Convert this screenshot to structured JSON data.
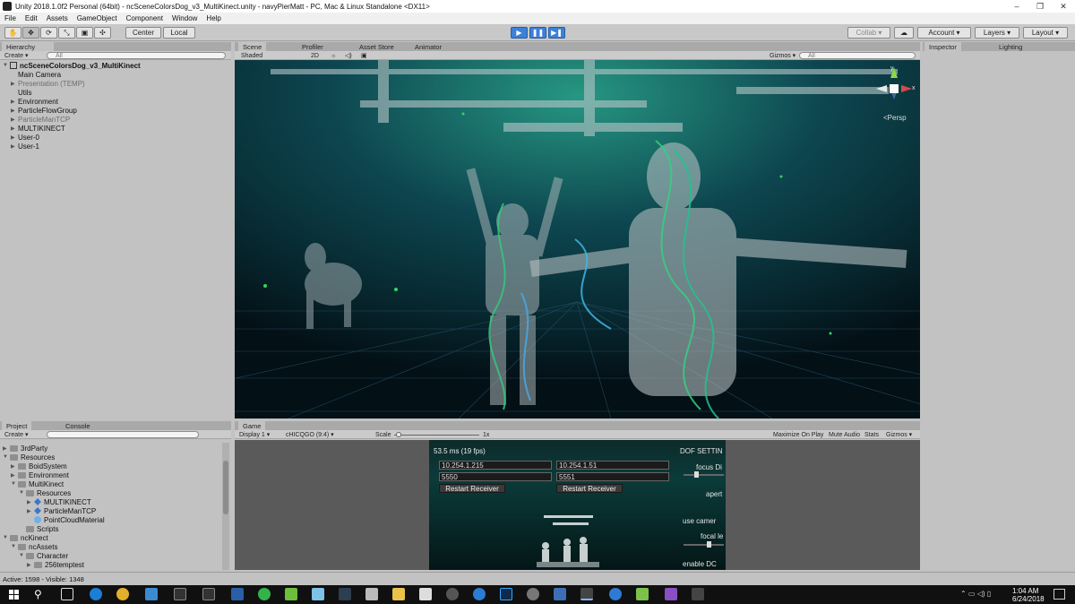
{
  "window": {
    "title": "Unity 2018.1.0f2 Personal (64bit) - ncSceneColorsDog_v3_MultiKinect.unity - navyPierMatt - PC, Mac & Linux Standalone <DX11>",
    "minimize": "–",
    "maximize": "❐",
    "close": "✕"
  },
  "menu": [
    "File",
    "Edit",
    "Assets",
    "GameObject",
    "Component",
    "Window",
    "Help"
  ],
  "toolbar": {
    "tools": [
      "✋",
      "✥",
      "⟳",
      "⤡",
      "▣",
      "✣"
    ],
    "pivot": "Center",
    "space": "Local",
    "play_buttons": [
      "▶",
      "❚❚",
      "▶❚"
    ],
    "collab": "Collab ▾",
    "cloud_icon": "☁",
    "account": "Account ▾",
    "layers": "Layers ▾",
    "layout": "Layout ▾"
  },
  "hierarchy": {
    "tab": "Hierarchy",
    "create": "Create ▾",
    "search_placeholder": "All",
    "scene": "ncSceneColorsDog_v3_MultiKinect",
    "items": [
      {
        "label": "Main Camera",
        "indent": 1,
        "arrow": "",
        "dim": false
      },
      {
        "label": "Presentation (TEMP)",
        "indent": 1,
        "arrow": "▶",
        "dim": true
      },
      {
        "label": "Utils",
        "indent": 1,
        "arrow": "",
        "dim": false
      },
      {
        "label": "Environment",
        "indent": 1,
        "arrow": "▶",
        "dim": false
      },
      {
        "label": "ParticleFlowGroup",
        "indent": 1,
        "arrow": "▶",
        "dim": false
      },
      {
        "label": "ParticleManTCP",
        "indent": 1,
        "arrow": "▶",
        "dim": true
      },
      {
        "label": "MULTIKINECT",
        "indent": 1,
        "arrow": "▶",
        "dim": false
      },
      {
        "label": "User-0",
        "indent": 1,
        "arrow": "▶",
        "dim": false
      },
      {
        "label": "User-1",
        "indent": 1,
        "arrow": "▶",
        "dim": false
      }
    ]
  },
  "scene": {
    "tabs": [
      "Scene",
      "Profiler",
      "Asset Store",
      "Animator"
    ],
    "shading": "Shaded",
    "mode_2d": "2D",
    "gizmos": "Gizmos ▾",
    "search_placeholder": "All",
    "projection": "<Persp",
    "axis_y": "y",
    "axis_x": "x"
  },
  "inspector": {
    "tabs": [
      "Inspector",
      "Lighting"
    ]
  },
  "project": {
    "tabs": [
      "Project",
      "Console"
    ],
    "create": "Create ▾",
    "items": [
      {
        "label": "3rdParty",
        "indent": 0,
        "arrow": "▶",
        "icon": "folder"
      },
      {
        "label": "Resources",
        "indent": 0,
        "arrow": "▼",
        "icon": "folder"
      },
      {
        "label": "BoidSystem",
        "indent": 1,
        "arrow": "▶",
        "icon": "folder"
      },
      {
        "label": "Environment",
        "indent": 1,
        "arrow": "▶",
        "icon": "folder"
      },
      {
        "label": "MultiKinect",
        "indent": 1,
        "arrow": "▼",
        "icon": "folder"
      },
      {
        "label": "Resources",
        "indent": 2,
        "arrow": "▼",
        "icon": "folder"
      },
      {
        "label": "MULTIKINECT",
        "indent": 3,
        "arrow": "▶",
        "icon": "cube"
      },
      {
        "label": "ParticleManTCP",
        "indent": 3,
        "arrow": "▶",
        "icon": "cube"
      },
      {
        "label": "PointCloudMaterial",
        "indent": 3,
        "arrow": "",
        "icon": "ball"
      },
      {
        "label": "Scripts",
        "indent": 2,
        "arrow": "",
        "icon": "folder"
      },
      {
        "label": "ncKinect",
        "indent": 0,
        "arrow": "▼",
        "icon": "folder"
      },
      {
        "label": "ncAssets",
        "indent": 1,
        "arrow": "▼",
        "icon": "folder"
      },
      {
        "label": "Character",
        "indent": 2,
        "arrow": "▼",
        "icon": "folder"
      },
      {
        "label": "256temptest",
        "indent": 3,
        "arrow": "▶",
        "icon": "folder"
      }
    ]
  },
  "game": {
    "tab": "Game",
    "display": "Display 1 ▾",
    "aspect": "cHICQGO (9:4) ▾",
    "scale_label": "Scale",
    "scale_value": "1x",
    "toggles": [
      "Maximize On Play",
      "Mute Audio",
      "Stats",
      "Gizmos ▾"
    ],
    "fps": "53.5 ms (19 fps)",
    "receivers": [
      {
        "ip": "10.254.1.215",
        "port": "5550",
        "button": "Restart Receiver"
      },
      {
        "ip": "10.254.1.51",
        "port": "5551",
        "button": "Restart Receiver"
      }
    ],
    "dof": {
      "title": "DOF SETTIN",
      "focus": "focus Di",
      "aperture": "apert",
      "use_camera": "use camer",
      "focal": "focal le",
      "enable": "enable DC"
    }
  },
  "status": "Active: 1598 - Visible: 1348",
  "taskbar": {
    "start_icon": "windows-icon",
    "search_icon": "⚲",
    "time": "1:04 AM",
    "date": "6/24/2018"
  }
}
